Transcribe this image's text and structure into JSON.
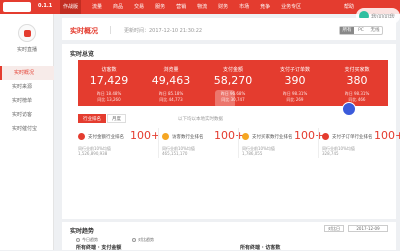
{
  "topbar": {
    "version": "0.1.1",
    "nav": [
      "作战版",
      "流量",
      "商品",
      "交易",
      "服务",
      "营销",
      "物流",
      "财务",
      "市场",
      "竞争",
      "业务专区"
    ],
    "active_index": 0,
    "right_text": "帮助"
  },
  "watermark": {
    "text": "我问问我"
  },
  "sidebar": {
    "title": "实时直播",
    "items": [
      {
        "label": "实时概况",
        "active": true
      },
      {
        "label": "实时来源",
        "active": false
      },
      {
        "label": "实时榜单",
        "active": false
      },
      {
        "label": "实时访客",
        "active": false
      },
      {
        "label": "实时催付宝",
        "active": false
      }
    ]
  },
  "header": {
    "title": "实时概况",
    "updated": "更新时间：2017-12-10 21:30:22",
    "devices": [
      "所有",
      "PC",
      "无线"
    ],
    "device_active": 0
  },
  "panel": {
    "title": "实时总览",
    "cards": [
      {
        "label": "访客数",
        "value": "17,429",
        "sub1": "昨日 18.48%",
        "sub2": "同比 13,260"
      },
      {
        "label": "浏览量",
        "value": "49,463",
        "sub1": "昨日 85.18%",
        "sub2": "同比 44,773"
      },
      {
        "label": "支付金额",
        "value": "58,270",
        "sub1": "昨日 96.68%",
        "sub2": "同比 30,747"
      },
      {
        "label": "支付子订单数",
        "value": "390",
        "sub1": "昨日 98.31%",
        "sub2": "同比 269"
      },
      {
        "label": "支付买家数",
        "value": "380",
        "sub1": "昨日 98.31%",
        "sub2": "同比 466"
      }
    ],
    "tabs": [
      "行业排名",
      "月度"
    ],
    "tabs_active": 0,
    "tabs_note": "以下均以本地实时数据",
    "ranks": [
      {
        "label": "支付金额行业排名",
        "value": "100+",
        "row1": "同行业前10%均值",
        "row2": "1,526,890,938",
        "color": "#e43c2f"
      },
      {
        "label": "访客数行业排名",
        "value": "100+",
        "row1": "同行业前10%均值",
        "row2": "465,151,170",
        "color": "#f5a623"
      },
      {
        "label": "支付买家数行业排名",
        "value": "100+",
        "row1": "同行业前10%均值",
        "row2": "1,786,055",
        "color": "#f5a623"
      },
      {
        "label": "支付子订单行业排名",
        "value": "100+",
        "row1": "同行业前10%均值",
        "row2": "328,745",
        "color": "#e43c2f"
      }
    ]
  },
  "panel2": {
    "title": "实时趋势",
    "compare": "对比日",
    "date": "2017-12-09",
    "radios": [
      "今日趋势",
      "对比趋势"
    ],
    "sections": [
      "所有终端 · 支付金额",
      "所有终端 · 访客数"
    ]
  }
}
